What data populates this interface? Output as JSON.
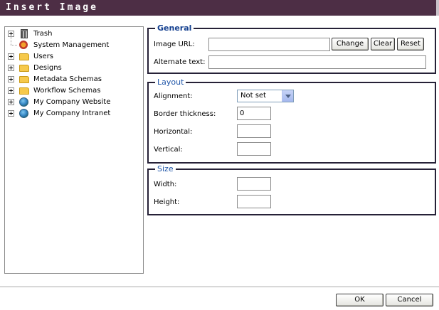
{
  "dialog": {
    "title": "Insert Image"
  },
  "tree": {
    "items": [
      {
        "label": "Trash",
        "icon": "trash-icon",
        "expandable": true
      },
      {
        "label": "System Management",
        "icon": "system-management-icon",
        "expandable": false
      },
      {
        "label": "Users",
        "icon": "folder-icon",
        "expandable": true
      },
      {
        "label": "Designs",
        "icon": "folder-icon",
        "expandable": true
      },
      {
        "label": "Metadata Schemas",
        "icon": "folder-icon",
        "expandable": true
      },
      {
        "label": "Workflow Schemas",
        "icon": "folder-icon",
        "expandable": true
      },
      {
        "label": "My Company Website",
        "icon": "globe-icon",
        "expandable": true
      },
      {
        "label": "My Company Intranet",
        "icon": "globe-icon",
        "expandable": true
      }
    ]
  },
  "general": {
    "legend": "General",
    "image_url_label": "Image URL:",
    "image_url_value": "",
    "change_label": "Change",
    "clear_label": "Clear",
    "reset_label": "Reset",
    "alt_text_label": "Alternate text:",
    "alt_text_value": ""
  },
  "layout": {
    "legend": "Layout",
    "alignment_label": "Alignment:",
    "alignment_value": "Not set",
    "border_label": "Border thickness:",
    "border_value": "0",
    "horizontal_label": "Horizontal:",
    "horizontal_value": "",
    "vertical_label": "Vertical:",
    "vertical_value": ""
  },
  "size": {
    "legend": "Size",
    "width_label": "Width:",
    "width_value": "",
    "height_label": "Height:",
    "height_value": ""
  },
  "footer": {
    "ok_label": "OK",
    "cancel_label": "Cancel"
  },
  "colors": {
    "titlebar": "#4d2e45",
    "border": "#262137",
    "legend": "#1f55a8",
    "folder": "#f6c94b"
  }
}
